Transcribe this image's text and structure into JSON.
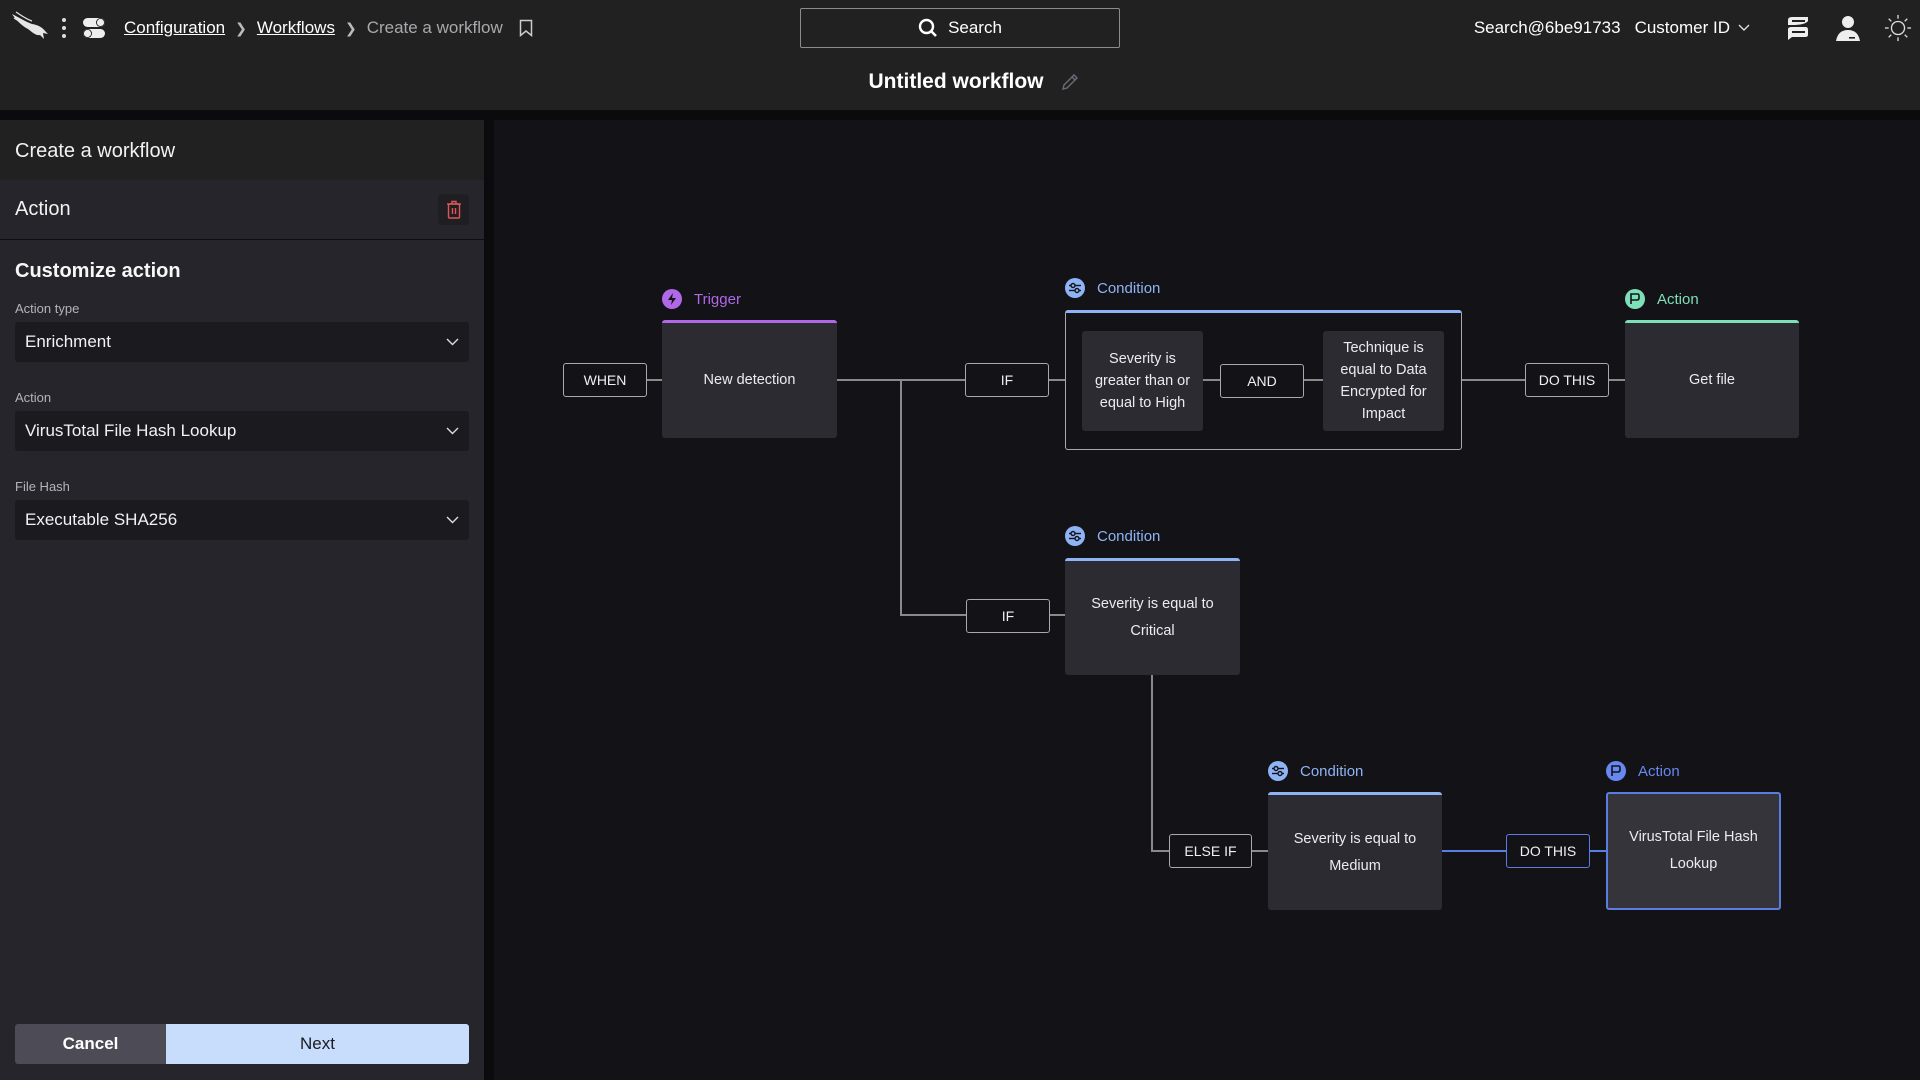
{
  "header": {
    "breadcrumb": [
      {
        "label": "Configuration"
      },
      {
        "label": "Workflows"
      },
      {
        "label": "Create a workflow"
      }
    ],
    "search_label": "Search",
    "user": "Search@6be91733",
    "customer_label": "Customer ID",
    "workflow_title": "Untitled workflow",
    "icons": [
      "falcon-logo",
      "kebab-icon",
      "apps-icon",
      "bookmark-icon",
      "search-icon",
      "chevron-down-icon",
      "messages-icon",
      "user-icon",
      "theme-sun-icon",
      "pencil-icon"
    ]
  },
  "panel": {
    "title": "Create a workflow",
    "section": "Action",
    "customize_title": "Customize action",
    "fields": [
      {
        "label": "Action type",
        "value": "Enrichment"
      },
      {
        "label": "Action",
        "value": "VirusTotal File Hash Lookup"
      },
      {
        "label": "File Hash",
        "value": "Executable SHA256"
      }
    ],
    "cancel_label": "Cancel",
    "next_label": "Next"
  },
  "canvas": {
    "colors": {
      "trigger": "#b068e8",
      "condition": "#8fb4f5",
      "action": "#7ee0b8",
      "selected": "#5a7de0"
    },
    "operators": {
      "when": "WHEN",
      "if1": "IF",
      "and": "AND",
      "do1": "DO THIS",
      "if2": "IF",
      "elseif": "ELSE IF",
      "do2": "DO THIS"
    },
    "trigger": {
      "type": "Trigger",
      "text": "New detection"
    },
    "condition1": {
      "type": "Condition",
      "left": "Severity is greater than or equal to High",
      "right": "Technique is equal to Data Encrypted for Impact"
    },
    "action1": {
      "type": "Action",
      "text": "Get file"
    },
    "condition2": {
      "type": "Condition",
      "text": "Severity is equal to Critical"
    },
    "condition3": {
      "type": "Condition",
      "text": "Severity is equal to Medium"
    },
    "action2": {
      "type": "Action",
      "text": "VirusTotal File Hash Lookup"
    }
  }
}
